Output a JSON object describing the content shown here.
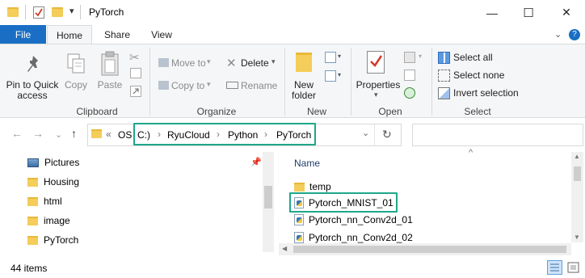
{
  "window": {
    "title": "PyTorch",
    "qat_dropdown": "▾",
    "minimize": "—",
    "maximize": "☐",
    "close": "✕"
  },
  "tabs": {
    "file": "File",
    "home": "Home",
    "share": "Share",
    "view": "View",
    "expand": "⌄",
    "help": "?"
  },
  "ribbon": {
    "clipboard": {
      "pin_line1": "Pin to Quick",
      "pin_line2": "access",
      "copy": "Copy",
      "paste": "Paste",
      "group": "Clipboard"
    },
    "organize": {
      "move_to": "Move to",
      "copy_to": "Copy to",
      "delete": "Delete",
      "rename": "Rename",
      "group": "Organize"
    },
    "new": {
      "new_folder_line1": "New",
      "new_folder_line2": "folder",
      "group": "New"
    },
    "open": {
      "properties": "Properties",
      "group": "Open"
    },
    "select": {
      "select_all": "Select all",
      "select_none": "Select none",
      "invert_selection": "Invert selection",
      "group": "Select"
    }
  },
  "address": {
    "back": "←",
    "forward": "→",
    "recent": "⌄",
    "up": "↑",
    "overflow": "«",
    "crumbs": [
      "OS",
      "C:)",
      "RyuCloud",
      "Python",
      "PyTorch"
    ],
    "sep": "›",
    "dropdown": "⌄",
    "refresh": "↻",
    "accent": "#1ea78a"
  },
  "nav_pane": {
    "items": [
      "Pictures",
      "Housing",
      "html",
      "image",
      "PyTorch"
    ],
    "pin": "📌"
  },
  "file_list": {
    "column_name": "Name",
    "sort_indicator": "^",
    "items": [
      {
        "name": "temp",
        "type": "folder"
      },
      {
        "name": "Pytorch_MNIST_01",
        "type": "py"
      },
      {
        "name": "Pytorch_nn_Conv2d_01",
        "type": "py"
      },
      {
        "name": "Pytorch_nn_Conv2d_02",
        "type": "py"
      }
    ]
  },
  "status": {
    "count": "44 items"
  }
}
